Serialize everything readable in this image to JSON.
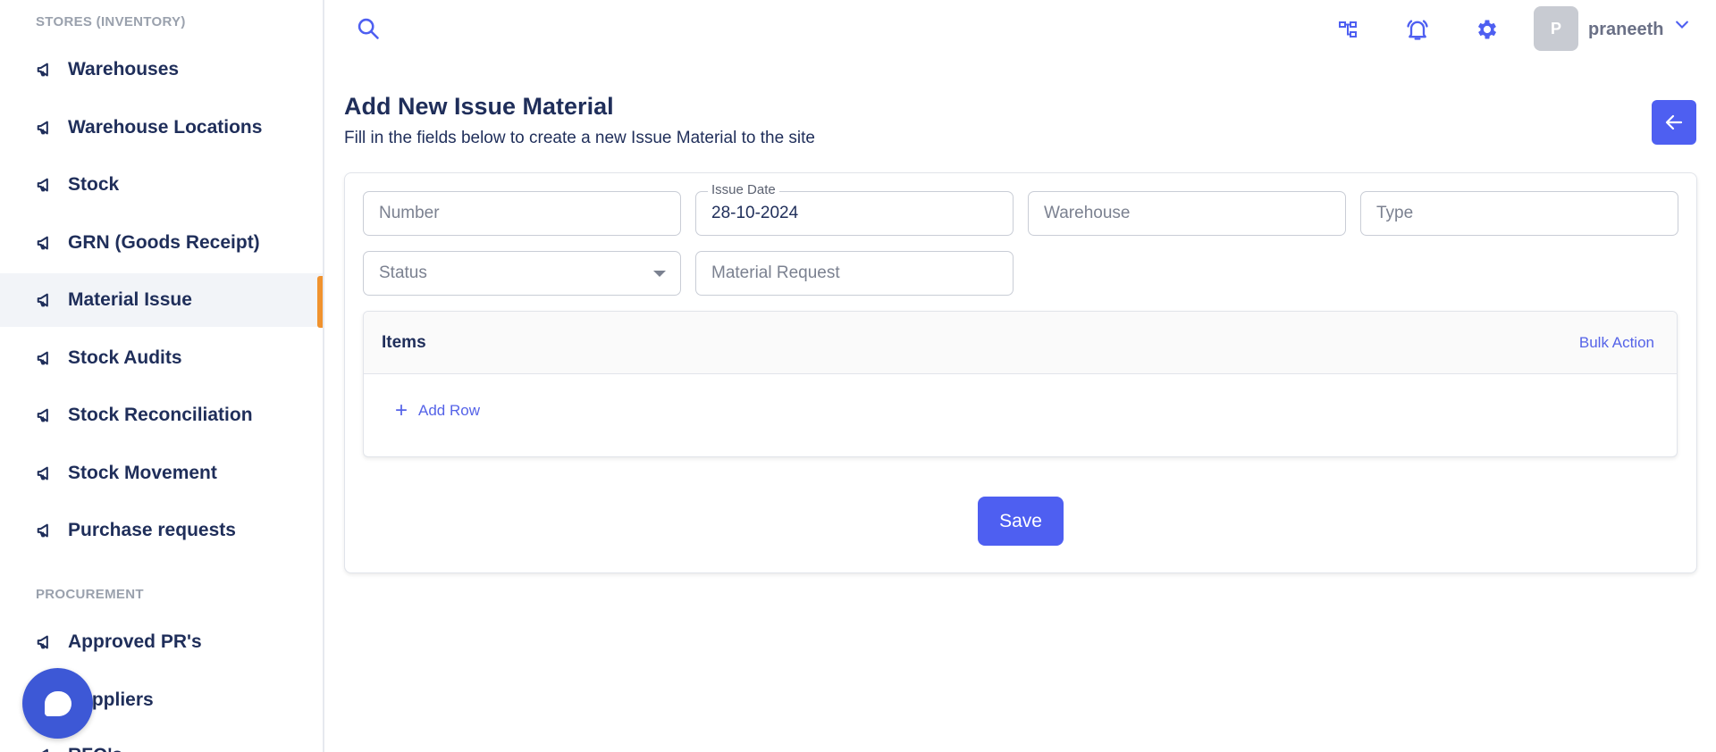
{
  "sidebar": {
    "section_inventory": "STORES (INVENTORY)",
    "section_procurement": "PROCUREMENT",
    "items": [
      {
        "label": "Warehouses",
        "icon": "megaphone-icon"
      },
      {
        "label": "Warehouse Locations",
        "icon": "megaphone-icon"
      },
      {
        "label": "Stock",
        "icon": "megaphone-icon"
      },
      {
        "label": "GRN (Goods Receipt)",
        "icon": "megaphone-icon"
      },
      {
        "label": "Material Issue",
        "icon": "megaphone-icon",
        "active": true
      },
      {
        "label": "Stock Audits",
        "icon": "megaphone-icon"
      },
      {
        "label": "Stock Reconciliation",
        "icon": "megaphone-icon"
      },
      {
        "label": "Stock Movement",
        "icon": "megaphone-icon"
      },
      {
        "label": "Purchase requests",
        "icon": "megaphone-icon"
      }
    ],
    "procurement_items": [
      {
        "label": "Approved PR's",
        "icon": "megaphone-icon"
      },
      {
        "label": "Suppliers",
        "icon": "megaphone-icon"
      },
      {
        "label": "RFQ's",
        "icon": "megaphone-icon"
      }
    ]
  },
  "topbar": {
    "search_icon": "search-icon",
    "icons": [
      "sitemap-icon",
      "bell-icon",
      "gear-icon"
    ],
    "avatar_initial": "P",
    "username": "praneeth"
  },
  "header": {
    "title": "Add New Issue Material",
    "subtitle": "Fill in the fields below to create a new Issue Material to the site"
  },
  "form": {
    "number": {
      "placeholder": "Number"
    },
    "issue_date": {
      "label": "Issue Date",
      "value": "28-10-2024"
    },
    "warehouse": {
      "placeholder": "Warehouse"
    },
    "type": {
      "placeholder": "Type"
    },
    "status": {
      "placeholder": "Status"
    },
    "material_request": {
      "placeholder": "Material Request"
    }
  },
  "items": {
    "title": "Items",
    "bulk_action": "Bulk Action",
    "add_row": "Add Row"
  },
  "actions": {
    "save": "Save"
  },
  "colors": {
    "primary": "#4e5ff1",
    "nav_text": "#1f2e5a",
    "active_indicator": "#f0922e",
    "chat_fab": "#3d58d6"
  }
}
